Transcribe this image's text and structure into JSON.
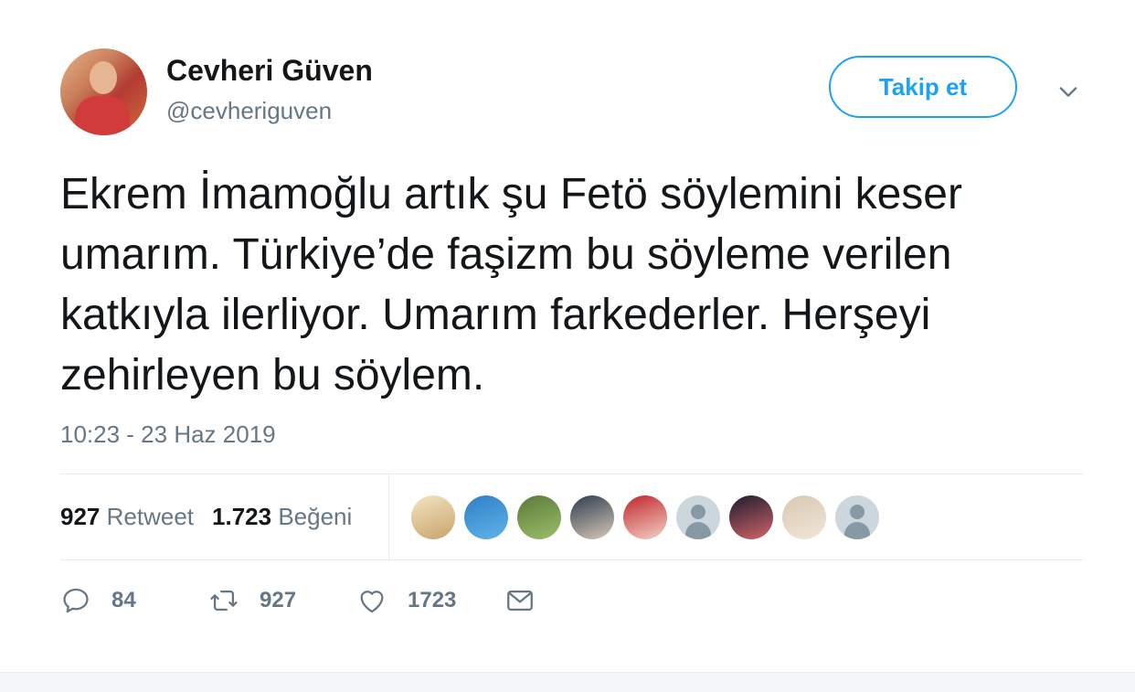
{
  "user": {
    "name": "Cevheri Güven",
    "handle": "@cevheriguven",
    "avatar_icon": "profile-photo"
  },
  "follow_button": {
    "label": "Takip et"
  },
  "menu_icon": "chevron-down-icon",
  "tweet": {
    "text": "Ekrem İmamoğlu artık şu Fetö söylemini keser\numarım. Türkiye’de faşizm bu söyleme verilen\nkatkıyla ilerliyor. Umarım farkederler. Herşeyi\nzehirleyen bu söylem.",
    "timestamp": "10:23 - 23 Haz 2019"
  },
  "stats": {
    "retweet_count": "927",
    "retweet_label": "Retweet",
    "like_count": "1.723",
    "like_label": "Beğeni"
  },
  "liker_avatars": [
    {
      "colors": [
        "#f3e3c3",
        "#c9a46a"
      ]
    },
    {
      "colors": [
        "#2f7fc8",
        "#5fb4e6"
      ]
    },
    {
      "colors": [
        "#5a7a3a",
        "#9bbf6a"
      ]
    },
    {
      "colors": [
        "#2c3e50",
        "#d9c7b8"
      ]
    },
    {
      "colors": [
        "#c0262c",
        "#f3d2c6"
      ]
    },
    {
      "colors": [
        "default"
      ]
    },
    {
      "colors": [
        "#1b1b2e",
        "#d4646a"
      ]
    },
    {
      "colors": [
        "#d9c8b2",
        "#f0e6d8"
      ]
    },
    {
      "colors": [
        "default"
      ]
    }
  ],
  "actions": {
    "reply_count": "84",
    "retweet_count": "927",
    "like_count": "1723"
  },
  "colors": {
    "accent": "#1da1f2",
    "muted": "#657786",
    "text": "#14171a",
    "divider": "#e6ecf0"
  }
}
